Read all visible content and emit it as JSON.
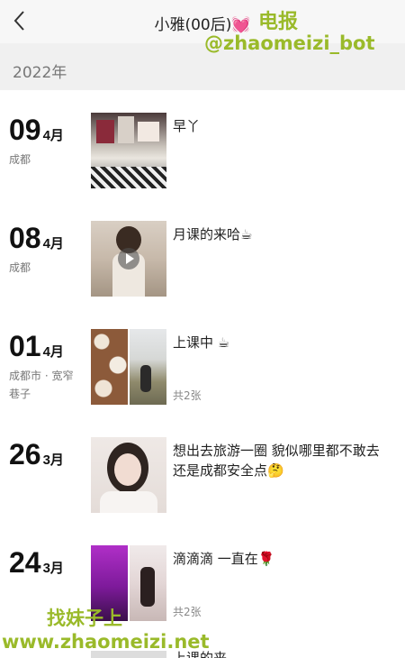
{
  "header": {
    "back_icon": "back-chevron-icon",
    "title": "小雅(00后)",
    "title_emoji": "💓"
  },
  "year": "2022年",
  "watermarks": {
    "top_line1": "电报",
    "top_line2": "@zhaomeizi_bot",
    "bottom_line1": "找妹子上",
    "bottom_line2": "www.zhaomeizi.net"
  },
  "posts": [
    {
      "day": "09",
      "month": "4月",
      "location": "成都",
      "text": "早丫",
      "count": ""
    },
    {
      "day": "08",
      "month": "4月",
      "location": "成都",
      "text": "月课的来哈☕",
      "count": ""
    },
    {
      "day": "01",
      "month": "4月",
      "location": "成都市 · 宽窄巷子",
      "text": "上课中 ☕",
      "count": "共2张"
    },
    {
      "day": "26",
      "month": "3月",
      "location": "",
      "text": "想出去旅游一圈 貌似哪里都不敢去 还是成都安全点🤔",
      "count": ""
    },
    {
      "day": "24",
      "month": "3月",
      "location": "",
      "text": "滴滴滴 一直在🌹",
      "count": "共2张"
    }
  ],
  "partial_post_text": "上课的来"
}
